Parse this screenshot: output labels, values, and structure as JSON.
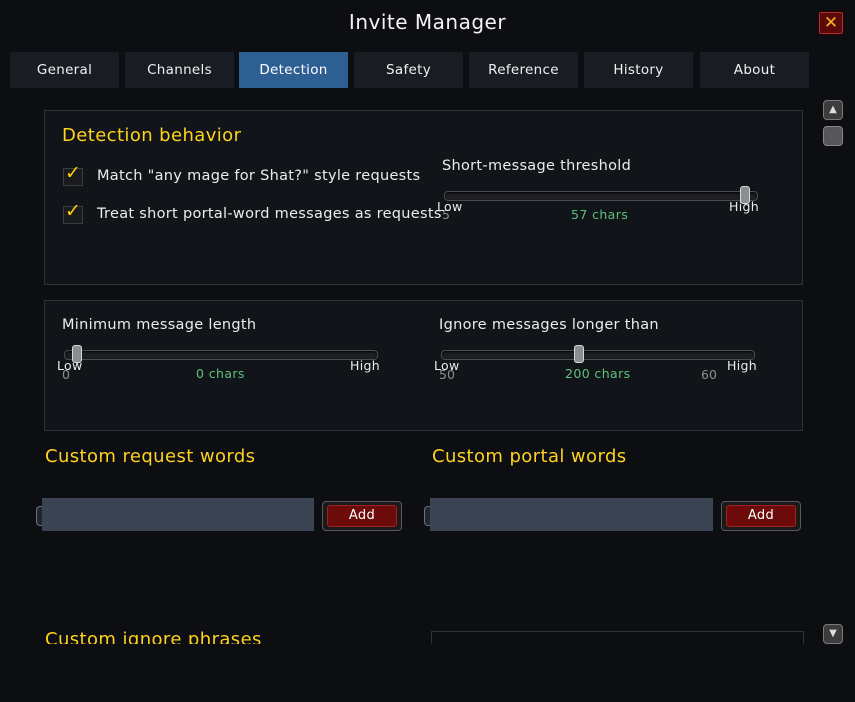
{
  "window": {
    "title": "Invite Manager",
    "close_icon": "close-icon"
  },
  "tabs": [
    {
      "label": "General"
    },
    {
      "label": "Channels"
    },
    {
      "label": "Detection",
      "active": true
    },
    {
      "label": "Safety"
    },
    {
      "label": "Reference"
    },
    {
      "label": "History"
    },
    {
      "label": "About"
    }
  ],
  "detection": {
    "title": "Detection behavior",
    "checkboxes": [
      {
        "label": "Match \"any mage for Shat?\" style requests",
        "checked": true
      },
      {
        "label": "Treat short portal-word messages as requests",
        "checked": true
      }
    ],
    "short_threshold": {
      "label": "Short-message threshold",
      "low": "Low",
      "high": "High",
      "min": "5",
      "value": 57,
      "value_text": "57 chars",
      "fraction": 0.96
    }
  },
  "length": {
    "min_length": {
      "label": "Minimum message length",
      "low": "Low",
      "high": "High",
      "min": "0",
      "value": 0,
      "value_text": "0 chars",
      "fraction": 0.04
    },
    "ignore_longer": {
      "label": "Ignore messages longer than",
      "low": "Low",
      "high": "High",
      "min": "50",
      "max": "60",
      "value": 200,
      "value_text": "200 chars",
      "fraction": 0.44
    }
  },
  "custom_request": {
    "heading": "Custom request words",
    "input_value": "",
    "add_label": "Add"
  },
  "custom_portal": {
    "heading": "Custom portal words",
    "input_value": "",
    "add_label": "Add"
  },
  "custom_ignore": {
    "heading": "Custom ignore phrases"
  },
  "colors": {
    "accent": "#ffd21f",
    "tab_active": "#2e5f93",
    "value": "#5fc07a",
    "button": "#6d0b0b"
  }
}
